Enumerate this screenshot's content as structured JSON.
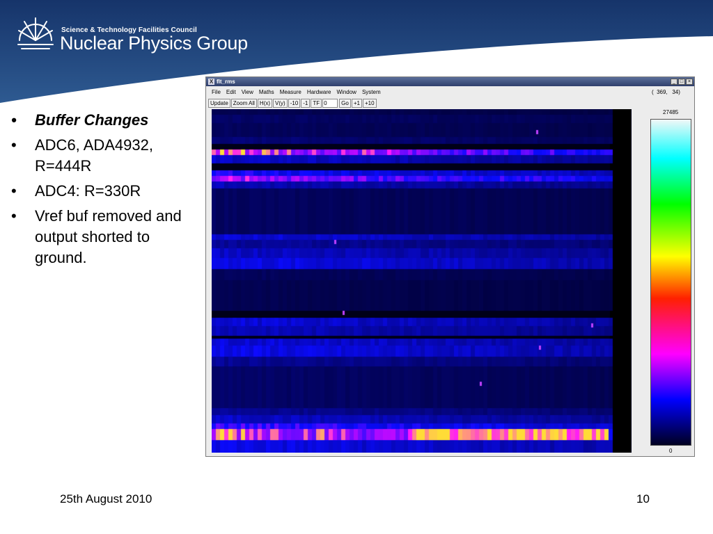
{
  "header": {
    "org": "Science & Technology Facilities Council",
    "group": "Nuclear Physics Group",
    "colors": {
      "banner_top": "#16346a",
      "banner_bottom": "#2e5a91"
    }
  },
  "bullets": [
    "Buffer Changes",
    "ADC6, ADA4932, R=444R",
    "ADC4: R=330R",
    "Vref buf removed and output shorted to ground."
  ],
  "footer": {
    "date": "25th August 2010",
    "page": "10"
  },
  "window": {
    "title": "flt_rms",
    "menu": [
      "File",
      "Edit",
      "View",
      "Maths",
      "Measure",
      "Hardware",
      "Window",
      "System"
    ],
    "coords": "(  369,   34)",
    "toolbar": {
      "update": "Update",
      "zoom_all": "Zoom All",
      "hx": "H(x)",
      "vy": "V(y)",
      "minus10": "-10",
      "minus1": "-1",
      "tf": "TF",
      "tf_value": "0",
      "go": "Go",
      "plus1": "+1",
      "plus10": "+10"
    },
    "scale": {
      "max": "27485",
      "min": "0"
    }
  }
}
